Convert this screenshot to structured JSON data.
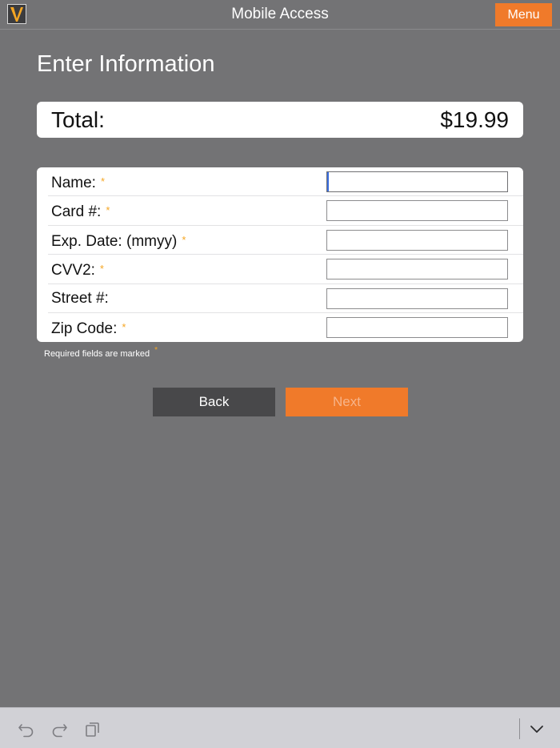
{
  "header": {
    "app_title": "Mobile Access",
    "menu_label": "Menu",
    "logo_icon": "v-logo-icon"
  },
  "page": {
    "title": "Enter Information"
  },
  "total": {
    "label": "Total:",
    "value": "$19.99"
  },
  "form": {
    "fields": [
      {
        "label": "Name:",
        "required": "*",
        "value": ""
      },
      {
        "label": "Card #:",
        "required": "*",
        "value": ""
      },
      {
        "label": "Exp. Date: (mmyy)",
        "required": "*",
        "value": ""
      },
      {
        "label": "CVV2:",
        "required": "*",
        "value": ""
      },
      {
        "label": "Street #:",
        "required": "",
        "value": ""
      },
      {
        "label": "Zip Code:",
        "required": "*",
        "value": ""
      }
    ],
    "required_note": "Required fields are marked",
    "required_mark": "*"
  },
  "actions": {
    "back_label": "Back",
    "next_label": "Next"
  },
  "keyboard_toolbar": {
    "icons": [
      "undo-icon",
      "redo-icon",
      "paste-icon",
      "chevron-down-icon"
    ]
  },
  "colors": {
    "accent": "#f07a2a",
    "background": "#737375",
    "required": "#f5a623"
  }
}
